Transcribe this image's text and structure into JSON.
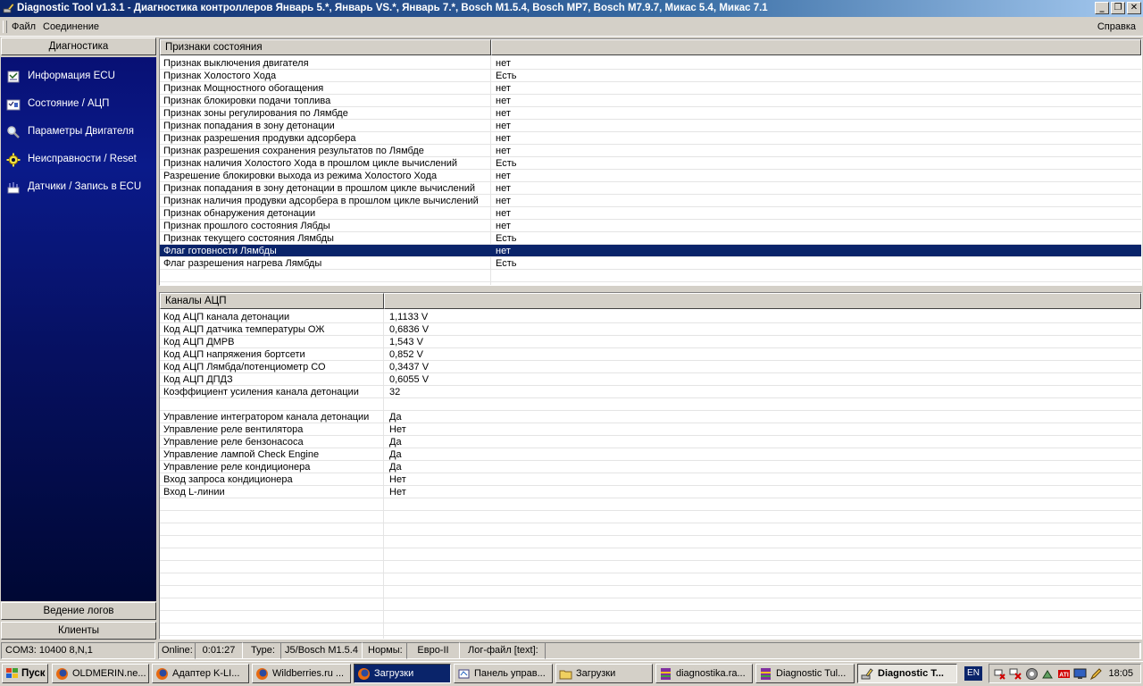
{
  "window": {
    "title": "Diagnostic Tool v1.3.1 - Диагностика контроллеров Январь 5.*, Январь VS.*, Январь 7.*, Bosch M1.5.4, Bosch MP7, Bosch M7.9.7, Микас 5.4, Микас 7.1",
    "minimize": "_",
    "restore": "❐",
    "close": "✕"
  },
  "menu": {
    "file": "Файл",
    "connection": "Соединение",
    "help": "Справка"
  },
  "sidebar": {
    "top_tab": "Диагностика",
    "items": [
      {
        "label": "Информация ECU",
        "icon": "info-icon"
      },
      {
        "label": "Состояние / АЦП",
        "icon": "state-icon"
      },
      {
        "label": "Параметры Двигателя",
        "icon": "search-icon"
      },
      {
        "label": "Неисправности / Reset",
        "icon": "gear-icon"
      },
      {
        "label": "Датчики / Запись в ECU",
        "icon": "sensor-icon"
      }
    ],
    "bottom_tabs": [
      "Ведение логов",
      "Клиенты"
    ]
  },
  "status_grid": {
    "header": "Признаки состояния",
    "header_value": "",
    "selected_index": 15,
    "rows": [
      {
        "name": "Признак выключения двигателя",
        "value": "нет"
      },
      {
        "name": "Признак Холостого Хода",
        "value": "Есть"
      },
      {
        "name": "Признак Мощностного обогащения",
        "value": "нет"
      },
      {
        "name": "Признак блокировки подачи топлива",
        "value": "нет"
      },
      {
        "name": "Признак зоны регулирования по Лямбде",
        "value": "нет"
      },
      {
        "name": "Признак попадания в зону детонации",
        "value": "нет"
      },
      {
        "name": "Признак разрешения продувки адсорбера",
        "value": "нет"
      },
      {
        "name": "Признак разрешения сохранения результатов по Лямбде",
        "value": "нет"
      },
      {
        "name": "Признак наличия Холостого Хода в прошлом цикле вычислений",
        "value": "Есть"
      },
      {
        "name": "Разрешение блокировки выхода из режима Холостого Хода",
        "value": "нет"
      },
      {
        "name": "Признак попадания в зону детонации в прошлом цикле вычислений",
        "value": "нет"
      },
      {
        "name": "Признак наличия продувки адсорбера в прошлом цикле вычислений",
        "value": "нет"
      },
      {
        "name": "Признак обнаружения детонации",
        "value": "нет"
      },
      {
        "name": "Признак прошлого состояния Лябды",
        "value": "нет"
      },
      {
        "name": "Признак текущего состояния Лямбды",
        "value": "Есть"
      },
      {
        "name": "Флаг готовности Лямбды",
        "value": "нет"
      },
      {
        "name": "Флаг разрешения нагрева Лямбды",
        "value": "Есть"
      }
    ]
  },
  "adc_grid": {
    "header": "Каналы АЦП",
    "header_value": "",
    "rows": [
      {
        "name": "Код АЦП канала детонации",
        "value": "1,1133 V"
      },
      {
        "name": "Код АЦП датчика температуры ОЖ",
        "value": "0,6836 V"
      },
      {
        "name": "Код АЦП ДМРВ",
        "value": "1,543 V"
      },
      {
        "name": "Код АЦП напряжения бортсети",
        "value": "0,852 V"
      },
      {
        "name": "Код АЦП Лямбда/потенциометр СО",
        "value": "0,3437 V"
      },
      {
        "name": "Код АЦП ДПДЗ",
        "value": "0,6055 V"
      },
      {
        "name": "Коэффициент усиления канала детонации",
        "value": "32"
      },
      {
        "name": "",
        "value": ""
      },
      {
        "name": "Управление интегратором канала детонации",
        "value": "Да"
      },
      {
        "name": "Управление реле вентилятора",
        "value": "Нет"
      },
      {
        "name": "Управление реле бензонасоса",
        "value": "Да"
      },
      {
        "name": "Управление лампой Check Engine",
        "value": "Да"
      },
      {
        "name": "Управление реле кондиционера",
        "value": "Да"
      },
      {
        "name": "Вход запроса кондиционера",
        "value": "Нет"
      },
      {
        "name": "Вход L-линии",
        "value": "Нет"
      }
    ]
  },
  "statusbar": {
    "port": "COM3: 10400 8,N,1",
    "online_label": "Online:",
    "online_value": "0:01:27",
    "type_label": "Type:",
    "type_value": "J5/Bosch M1.5.4",
    "norms_label": "Нормы:",
    "norms_value": "Евро-II",
    "logfile": "Лог-файл [text]:"
  },
  "taskbar": {
    "start": "Пуск",
    "buttons": [
      {
        "label": "OLDMERIN.ne...",
        "icon": "firefox-icon",
        "state": "normal"
      },
      {
        "label": "Адаптер K-LI...",
        "icon": "firefox-icon",
        "state": "normal"
      },
      {
        "label": "Wildberries.ru ...",
        "icon": "firefox-icon",
        "state": "normal"
      },
      {
        "label": "Загрузки",
        "icon": "firefox-icon",
        "state": "dark"
      },
      {
        "label": "Панель управ...",
        "icon": "control-panel-icon",
        "state": "normal"
      },
      {
        "label": "Загрузки",
        "icon": "folder-icon",
        "state": "normal"
      },
      {
        "label": "diagnostika.ra...",
        "icon": "winrar-icon",
        "state": "normal"
      },
      {
        "label": "Diagnostic Tul...",
        "icon": "winrar-icon",
        "state": "normal"
      },
      {
        "label": "Diagnostic T...",
        "icon": "diagnostic-tool-icon",
        "state": "pressed"
      }
    ],
    "lang": "EN",
    "clock": "18:05"
  },
  "colors": {
    "selection": "#0a246a",
    "sidebar_top": "#081074",
    "sidebar_bottom": "#000834",
    "chrome": "#d4d0c8"
  }
}
